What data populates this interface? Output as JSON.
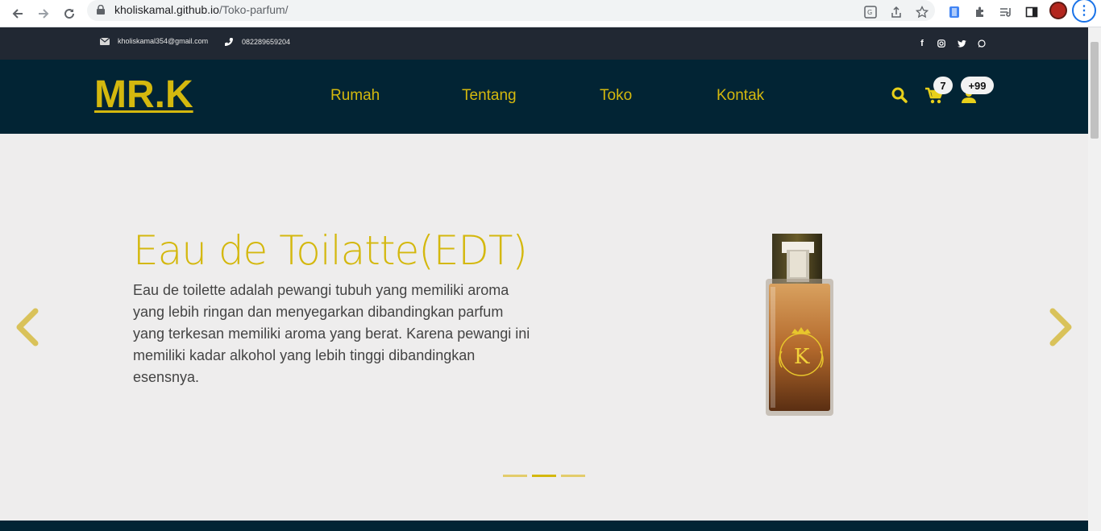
{
  "browser": {
    "url_host": "kholiskamal.github.io",
    "url_path": "/Toko-parfum/"
  },
  "topbar": {
    "email": "kholiskamal354@gmail.com",
    "phone": "082289659204"
  },
  "header": {
    "logo": "MR.K",
    "nav": [
      "Rumah",
      "Tentang",
      "Toko",
      "Kontak"
    ],
    "cart_count": "7",
    "user_count": "+99"
  },
  "hero": {
    "title": "Eau de Toilatte(EDT)",
    "description": "Eau de toilette adalah pewangi tubuh yang memiliki aroma yang lebih ringan dan menyegarkan dibandingkan parfum yang terkesan memiliki aroma yang berat. Karena pewangi ini memiliki kadar alkohol yang lebih tinggi dibandingkan esensnya.",
    "active_slide_index": 1,
    "slide_count": 3
  },
  "colors": {
    "accent": "#d4b80e",
    "header_bg": "#022434",
    "topbar_bg": "#212833",
    "hero_bg": "#eeeded"
  }
}
